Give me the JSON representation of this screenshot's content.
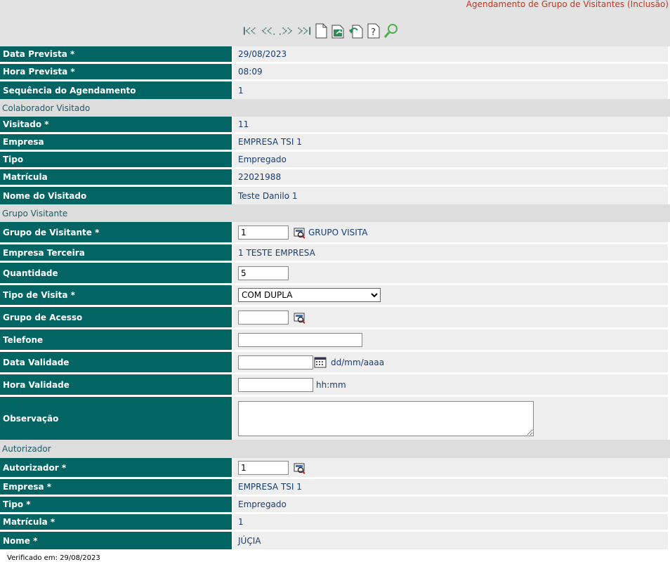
{
  "header": {
    "title": "Agendamento de Grupo de Visitantes (Inclusão)"
  },
  "toolbar": {
    "icons": [
      "first-record-icon",
      "previous-record-icon",
      "next-record-icon",
      "last-record-icon",
      "new-document-icon",
      "export-icon",
      "undo-icon",
      "help-icon",
      "search-icon"
    ]
  },
  "fields": {
    "data_prevista": {
      "label": "Data Prevista *",
      "value": "29/08/2023"
    },
    "hora_prevista": {
      "label": "Hora Prevista *",
      "value": "08:09"
    },
    "sequencia": {
      "label": "Sequência do Agendamento",
      "value": "1"
    }
  },
  "colaborador": {
    "section": "Colaborador Visitado",
    "visitado": {
      "label": "Visitado *",
      "value": "11"
    },
    "empresa": {
      "label": "Empresa",
      "value": "EMPRESA TSI 1"
    },
    "tipo": {
      "label": "Tipo",
      "value": "Empregado"
    },
    "matricula": {
      "label": "Matrícula",
      "value": "22021988"
    },
    "nome": {
      "label": "Nome do Visitado",
      "value": "Teste Danilo 1"
    }
  },
  "grupo": {
    "section": "Grupo Visitante",
    "grupo_visitante": {
      "label": "Grupo de Visitante *",
      "value": "1",
      "lookup_text": "GRUPO VISITA"
    },
    "empresa_terceira": {
      "label": "Empresa Terceira",
      "value": "1 TESTE EMPRESA"
    },
    "quantidade": {
      "label": "Quantidade",
      "value": "5"
    },
    "tipo_visita": {
      "label": "Tipo de Visita *",
      "selected": "COM DUPLA"
    },
    "grupo_acesso": {
      "label": "Grupo de Acesso",
      "value": ""
    },
    "telefone": {
      "label": "Telefone",
      "value": ""
    },
    "data_validade": {
      "label": "Data Validade",
      "value": "",
      "hint": "dd/mm/aaaa"
    },
    "hora_validade": {
      "label": "Hora Validade",
      "value": "",
      "hint": "hh:mm"
    },
    "observacao": {
      "label": "Observação",
      "value": ""
    }
  },
  "autorizador": {
    "section": "Autorizador",
    "autorizador": {
      "label": "Autorizador *",
      "value": "1"
    },
    "empresa": {
      "label": "Empresa *",
      "value": "EMPRESA TSI 1"
    },
    "tipo": {
      "label": "Tipo *",
      "value": "Empregado"
    },
    "matricula": {
      "label": "Matrícula *",
      "value": "1"
    },
    "nome": {
      "label": "Nome *",
      "value": "JÚÇIA"
    }
  },
  "footer": {
    "text": "Verificado em: 29/08/2023"
  },
  "colors": {
    "label_bg": "#036464",
    "value_bg": "#eeeeee",
    "section_bg": "#dddddd",
    "title": "#c8321e"
  }
}
